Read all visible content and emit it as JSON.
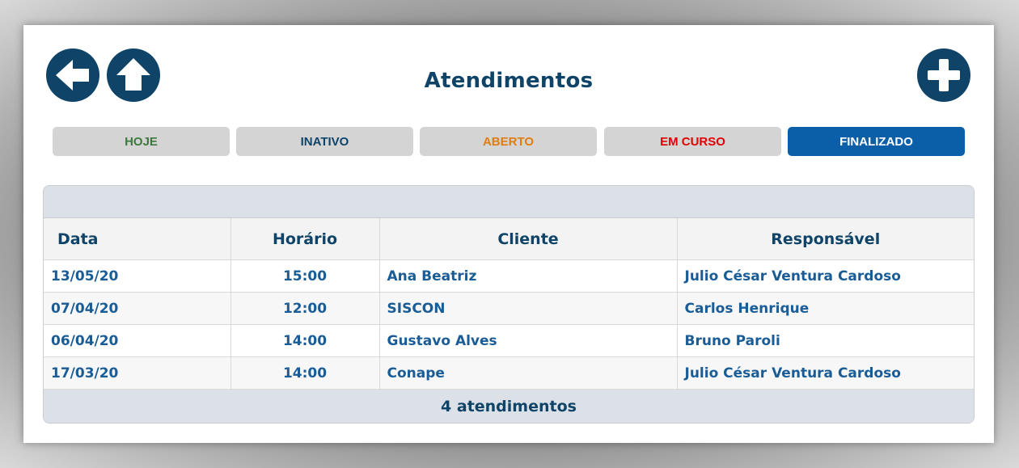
{
  "header": {
    "title": "Atendimentos"
  },
  "icons": {
    "back": "arrow-left-icon",
    "home": "house-icon",
    "add": "plus-icon"
  },
  "colors": {
    "primary": "#0f4468",
    "tab_active": "#0b5ea8",
    "hoje": "#3c7a3c",
    "inativo": "#0f4468",
    "aberto": "#e07d10",
    "em_curso": "#e00000"
  },
  "tabs": [
    {
      "label": "HOJE",
      "color": "#3c7a3c",
      "active": false
    },
    {
      "label": "INATIVO",
      "color": "#0f4468",
      "active": false
    },
    {
      "label": "ABERTO",
      "color": "#e07d10",
      "active": false
    },
    {
      "label": "EM CURSO",
      "color": "#e00000",
      "active": false
    },
    {
      "label": "FINALIZADO",
      "color": "#ffffff",
      "active": true
    }
  ],
  "table": {
    "columns": [
      "Data",
      "Horário",
      "Cliente",
      "Responsável"
    ],
    "rows": [
      [
        "13/05/20",
        "15:00",
        "Ana Beatriz",
        "Julio César Ventura Cardoso"
      ],
      [
        "07/04/20",
        "12:00",
        "SISCON",
        "Carlos Henrique"
      ],
      [
        "06/04/20",
        "14:00",
        "Gustavo Alves",
        "Bruno Paroli"
      ],
      [
        "17/03/20",
        "14:00",
        "Conape",
        "Julio César Ventura Cardoso"
      ]
    ],
    "footer": "4 atendimentos"
  }
}
